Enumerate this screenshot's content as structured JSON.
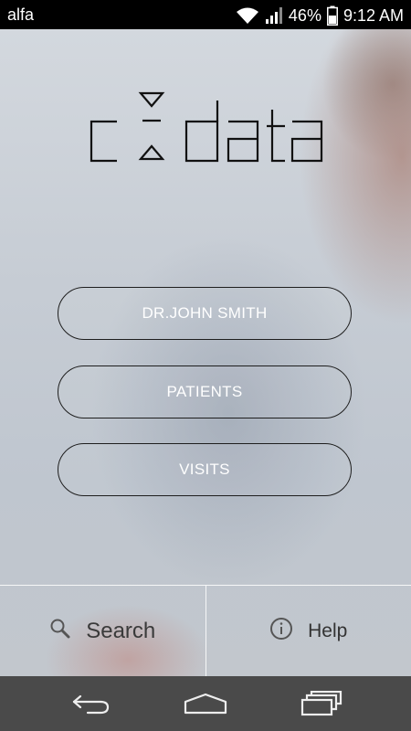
{
  "status_bar": {
    "carrier": "alfa",
    "battery": "46%",
    "time": "9:12 AM"
  },
  "logo": {
    "text": "c data"
  },
  "menu": {
    "doctor_label": "DR.JOHN SMITH",
    "patients_label": "PATIENTS",
    "visits_label": "VISITS"
  },
  "bottom": {
    "search_label": "Search",
    "help_label": "Help"
  },
  "icons": {
    "wifi": "wifi-icon",
    "signal": "signal-icon",
    "battery": "battery-icon",
    "search": "search-icon",
    "info": "info-icon",
    "back": "back-icon",
    "home": "home-icon",
    "recents": "recents-icon"
  }
}
